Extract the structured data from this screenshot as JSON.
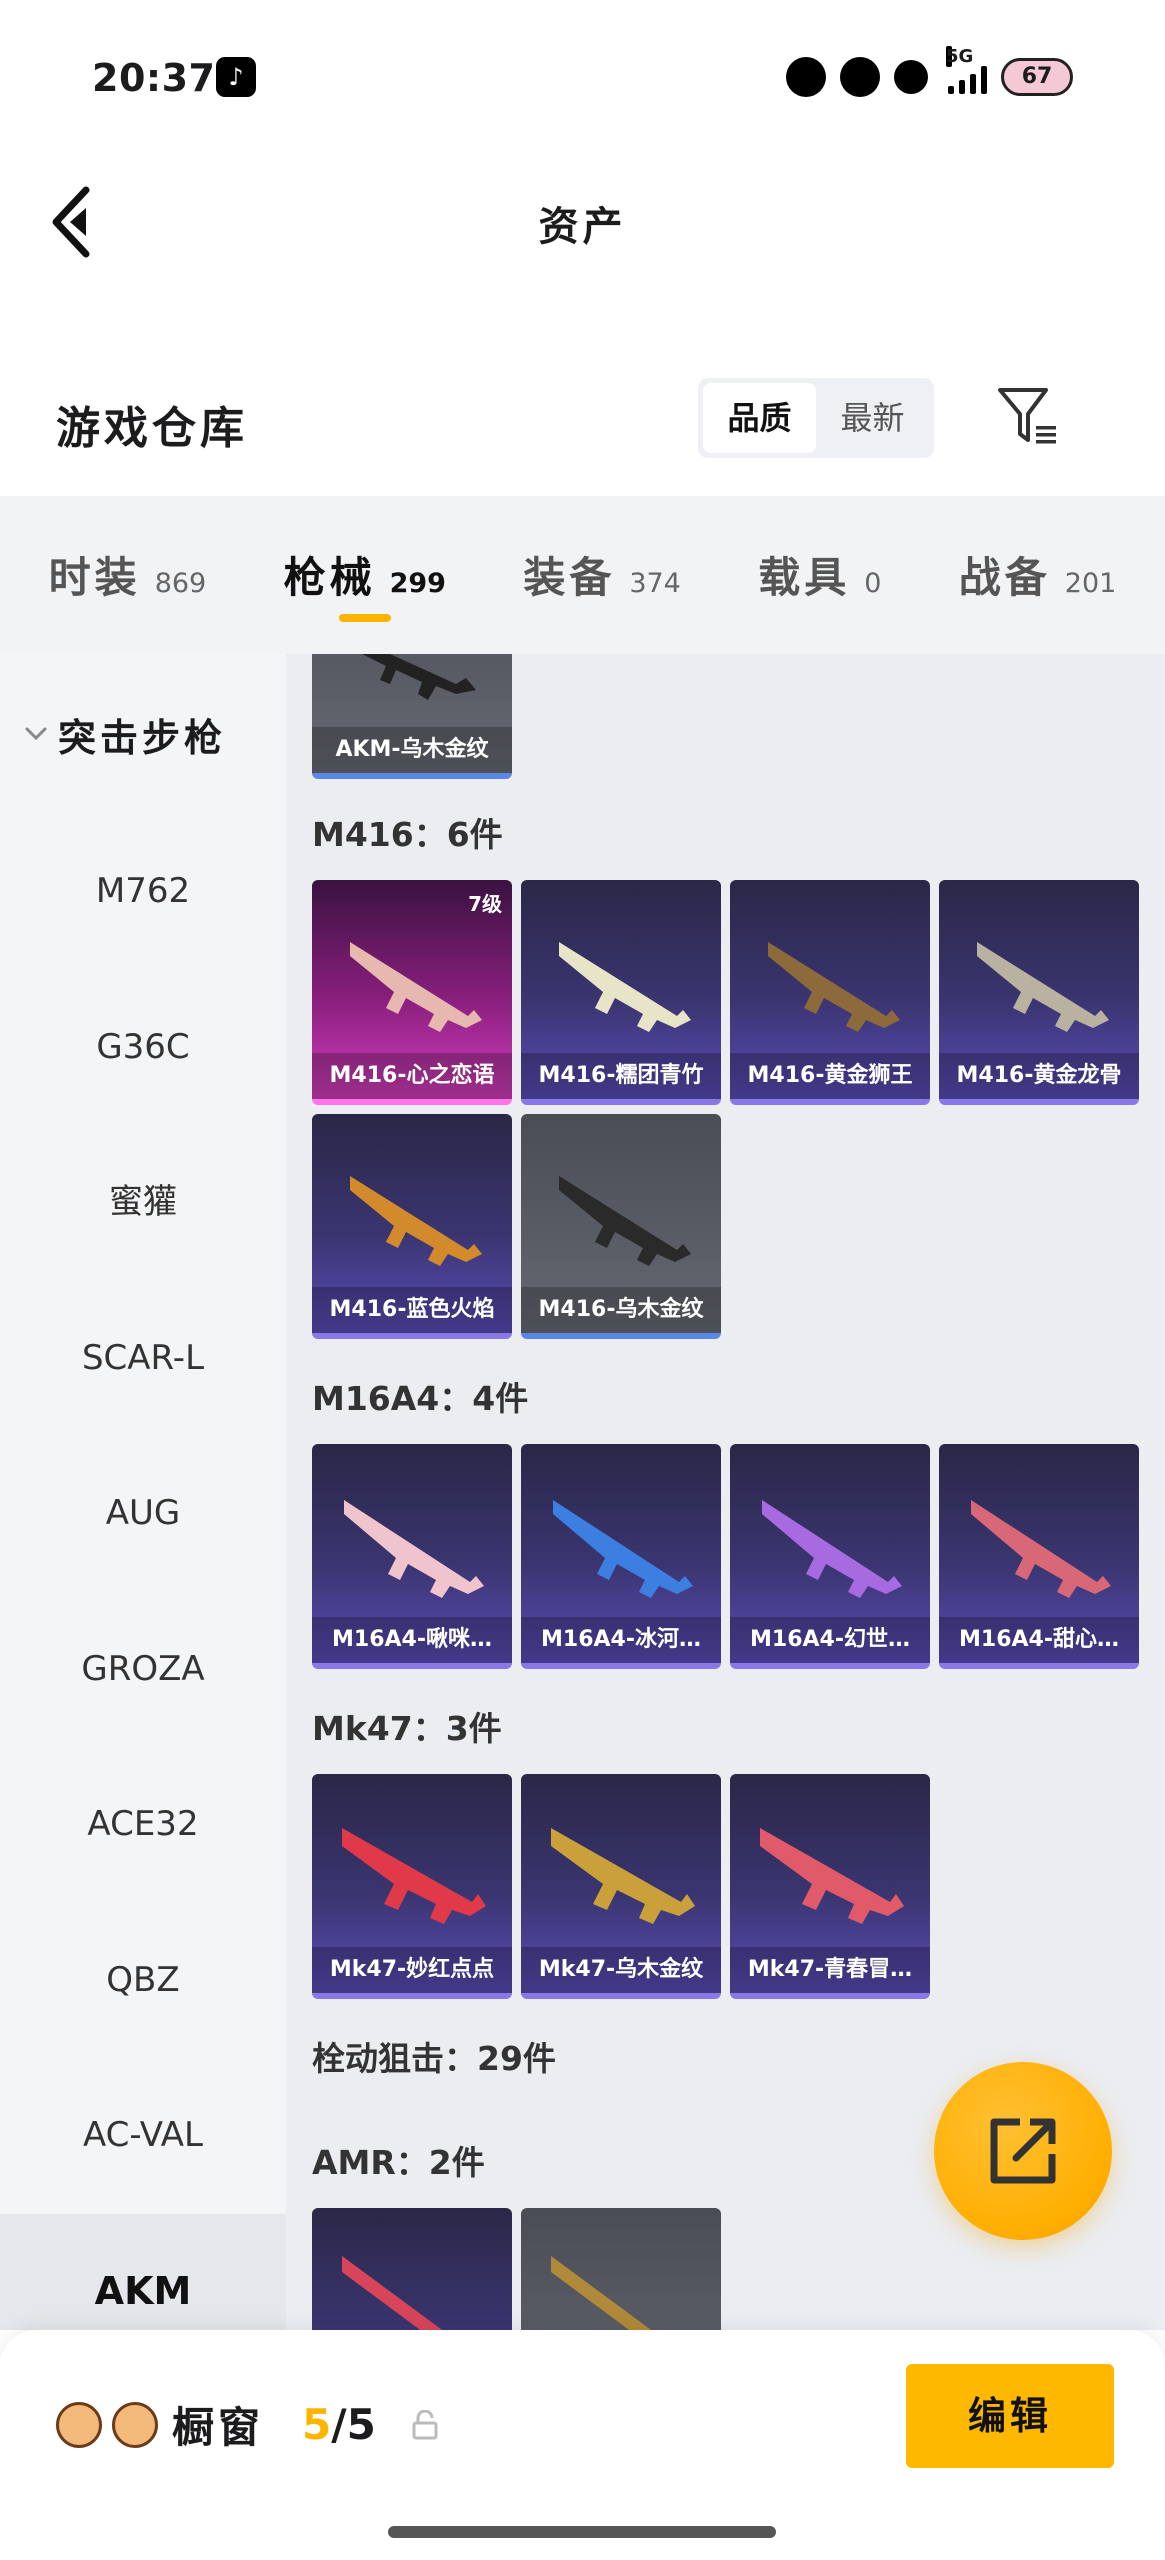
{
  "status_bar": {
    "time": "20:37",
    "network": "5G",
    "battery": "67"
  },
  "header": {
    "title": "资产"
  },
  "section": {
    "title": "游戏仓库",
    "sort_options": [
      "品质",
      "最新"
    ],
    "active_sort": "品质"
  },
  "tabs": [
    {
      "label": "时装",
      "count": "869"
    },
    {
      "label": "枪械",
      "count": "299"
    },
    {
      "label": "装备",
      "count": "374"
    },
    {
      "label": "载具",
      "count": "0"
    },
    {
      "label": "战备",
      "count": "201"
    }
  ],
  "active_tab": "枪械",
  "sidebar": {
    "category": "突击步枪",
    "items": [
      "M762",
      "G36C",
      "蜜獾",
      "SCAR-L",
      "AUG",
      "GROZA",
      "ACE32",
      "QBZ",
      "AC-VAL",
      "AKM"
    ],
    "active": "AKM"
  },
  "groups": [
    {
      "label": "",
      "items": [
        {
          "name": "AKM-乌木金纹",
          "rarity": "grey"
        }
      ]
    },
    {
      "label": "M416：6件",
      "items": [
        {
          "name": "M416-心之恋语",
          "rarity": "pink",
          "level": "7级"
        },
        {
          "name": "M416-糯团青竹",
          "rarity": "purple"
        },
        {
          "name": "M416-黄金狮王",
          "rarity": "purple"
        },
        {
          "name": "M416-黄金龙骨",
          "rarity": "purple"
        },
        {
          "name": "M416-蓝色火焰",
          "rarity": "purple"
        },
        {
          "name": "M416-乌木金纹",
          "rarity": "grey"
        }
      ]
    },
    {
      "label": "M16A4：4件",
      "items": [
        {
          "name": "M16A4-啾咪…",
          "rarity": "purple"
        },
        {
          "name": "M16A4-冰河…",
          "rarity": "purple"
        },
        {
          "name": "M16A4-幻世…",
          "rarity": "purple"
        },
        {
          "name": "M16A4-甜心…",
          "rarity": "purple"
        }
      ]
    },
    {
      "label": "Mk47：3件",
      "items": [
        {
          "name": "Mk47-妙红点点",
          "rarity": "purple"
        },
        {
          "name": "Mk47-乌木金纹",
          "rarity": "purple"
        },
        {
          "name": "Mk47-青春冒…",
          "rarity": "purple"
        }
      ]
    },
    {
      "label": "栓动狙击：29件",
      "items": []
    },
    {
      "label": "AMR：2件",
      "items": [
        {
          "name": "",
          "rarity": "purple"
        },
        {
          "name": "",
          "rarity": "grey"
        }
      ]
    }
  ],
  "bottom_bar": {
    "label": "橱窗",
    "count_current": "5",
    "count_sep": "/",
    "count_total": "5",
    "edit_label": "编辑"
  },
  "colors": {
    "accent": "#ffb400",
    "purple_card": "#3a3570",
    "pink_card": "#8a1f7e",
    "grey_card": "#5a5d66"
  },
  "icons": [
    "back-arrow-icon",
    "filter-icon",
    "share-icon",
    "lock-icon",
    "chevron-down-icon"
  ]
}
